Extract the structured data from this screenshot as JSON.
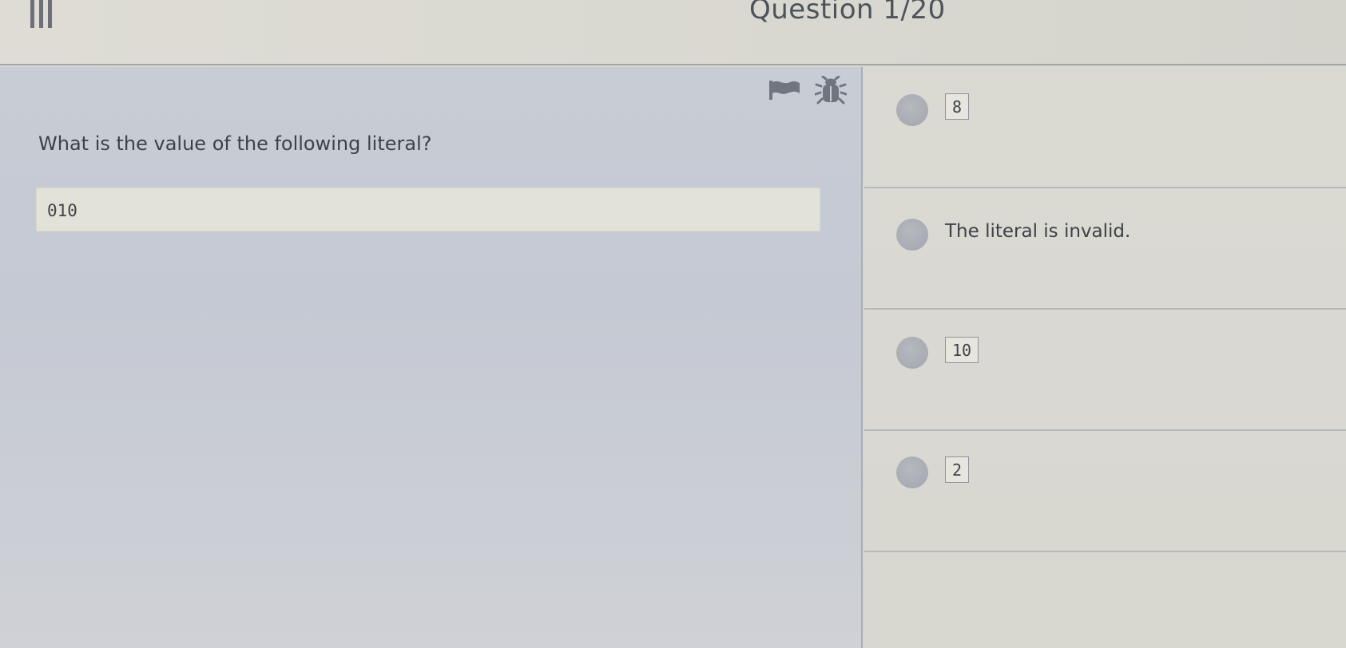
{
  "header": {
    "title": "Question 1/20",
    "menu_icon": "hamburger-menu-icon"
  },
  "toolbar": {
    "flag_icon": "flag-icon",
    "bug_icon": "bug-icon"
  },
  "question": {
    "prompt": "What is the value of the following literal?",
    "code": "010"
  },
  "options": [
    {
      "label": "8",
      "style": "code"
    },
    {
      "label": "The literal is invalid.",
      "style": "text"
    },
    {
      "label": "10",
      "style": "code"
    },
    {
      "label": "2",
      "style": "code"
    }
  ],
  "colors": {
    "left_panel": "#c8ccd5",
    "right_panel": "#dad9d2",
    "code_box": "#e3e2d8",
    "radio": "#a8abb3",
    "text": "#3d4148"
  }
}
